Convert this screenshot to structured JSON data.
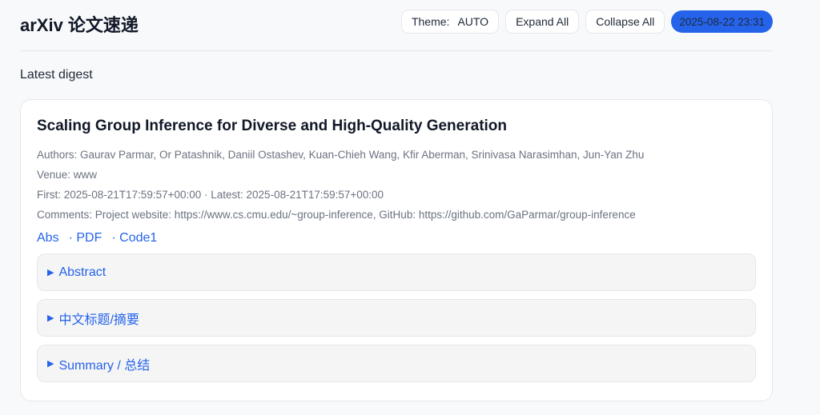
{
  "header": {
    "title": "arXiv 论文速递",
    "theme_label": "Theme:",
    "theme_value": "AUTO",
    "expand_all": "Expand All",
    "collapse_all": "Collapse All",
    "timestamp": "2025-08-22 23:31"
  },
  "section_title": "Latest digest",
  "paper": {
    "title": "Scaling Group Inference for Diverse and High-Quality Generation",
    "authors": "Authors: Gaurav Parmar, Or Patashnik, Daniil Ostashev, Kuan-Chieh Wang, Kfir Aberman, Srinivasa Narasimhan, Jun-Yan Zhu",
    "venue": "Venue: www",
    "dates": "First: 2025-08-21T17:59:57+00:00 · Latest: 2025-08-21T17:59:57+00:00",
    "comments": "Comments: Project website: https://www.cs.cmu.edu/~group-inference, GitHub: https://github.com/GaParmar/group-inference",
    "links": [
      "Abs",
      "· PDF",
      "· Code1"
    ],
    "sections": [
      "Abstract",
      "中文标题/摘要",
      "Summary / 总结"
    ]
  }
}
